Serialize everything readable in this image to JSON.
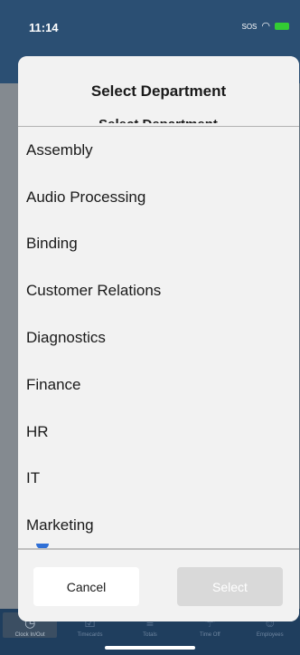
{
  "status_bar": {
    "time": "11:14",
    "carrier": "SOS",
    "wifi_icon": "wifi-icon",
    "battery_icon": "battery-icon",
    "battery_color": "#33cc33"
  },
  "modal": {
    "title": "Select Department",
    "departments": [
      "Assembly",
      "Audio Processing",
      "Binding",
      "Customer Relations",
      "Diagnostics",
      "Finance",
      "HR",
      "IT",
      "Marketing"
    ],
    "cancel_label": "Cancel",
    "select_label": "Select",
    "select_enabled": false
  },
  "tab_bar": {
    "tabs": [
      {
        "label": "Clock In/Out",
        "icon": "clock-icon",
        "active": true
      },
      {
        "label": "Timecards",
        "icon": "timecard-icon",
        "active": false
      },
      {
        "label": "Totals",
        "icon": "totals-icon",
        "active": false
      },
      {
        "label": "Time Off",
        "icon": "time-off-icon",
        "active": false
      },
      {
        "label": "Employees",
        "icon": "employees-icon",
        "active": false
      }
    ]
  },
  "colors": {
    "accent": "#2f6fd6",
    "header_blue": "#2b4f73"
  }
}
